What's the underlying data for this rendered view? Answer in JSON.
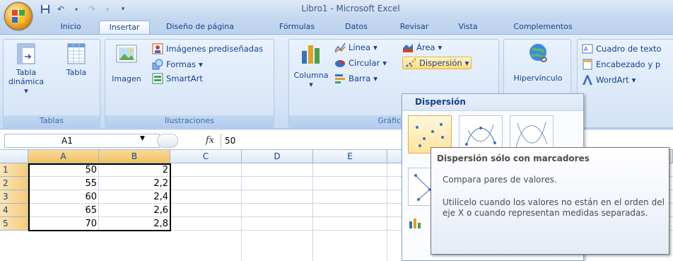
{
  "window": {
    "title": "Libro1 - Microsoft Excel"
  },
  "quick_access": [
    {
      "icon": "save-icon",
      "glyph": "▣"
    },
    {
      "icon": "undo-icon",
      "glyph": "↶"
    },
    {
      "icon": "redo-icon",
      "glyph": "↷"
    },
    {
      "icon": "customize-qat-icon",
      "glyph": "▾"
    }
  ],
  "tabs": [
    {
      "label": "Inicio",
      "active": false
    },
    {
      "label": "Insertar",
      "active": true
    },
    {
      "label": "Diseño de página",
      "active": false
    },
    {
      "label": "Fórmulas",
      "active": false
    },
    {
      "label": "Datos",
      "active": false
    },
    {
      "label": "Revisar",
      "active": false
    },
    {
      "label": "Vista",
      "active": false
    },
    {
      "label": "Complementos",
      "active": false
    }
  ],
  "ribbon": {
    "tablas": {
      "label": "Tablas",
      "pivot_line1": "Tabla",
      "pivot_line2": "dinámica",
      "table": "Tabla"
    },
    "ilustraciones": {
      "label": "Ilustraciones",
      "image": "Imagen",
      "clipart": "Imágenes prediseñadas",
      "shapes": "Formas",
      "smartart": "SmartArt"
    },
    "graficos": {
      "label": "Gráficos",
      "column": "Columna",
      "line": "Línea",
      "pie": "Circular",
      "bar": "Barra",
      "area": "Área",
      "scatter": "Dispersión"
    },
    "vinculos": {
      "hyperlink": "Hipervínculo"
    },
    "texto": {
      "textbox": "Cuadro de texto",
      "header": "Encabezado y p",
      "wordart": "WordArt"
    }
  },
  "formula_bar": {
    "name_box": "A1",
    "fx": "fx",
    "content": "50"
  },
  "grid": {
    "columns": [
      "A",
      "B",
      "C",
      "D",
      "E"
    ],
    "rows": [
      {
        "n": "1",
        "a": "50",
        "b": "2"
      },
      {
        "n": "2",
        "a": "55",
        "b": "2,2"
      },
      {
        "n": "3",
        "a": "60",
        "b": "2,4"
      },
      {
        "n": "4",
        "a": "65",
        "b": "2,6"
      },
      {
        "n": "5",
        "a": "70",
        "b": "2,8"
      }
    ]
  },
  "scatter_gallery": {
    "title": "Dispersión"
  },
  "tooltip": {
    "title": "Dispersión sólo con marcadores",
    "description": "Compara pares de valores.",
    "detail": "Utilícelo cuando los valores no están en el orden del eje X o cuando representan medidas separadas."
  },
  "colors": {
    "accent": "#15428b",
    "ribbon": "#d6e5f7",
    "selected": "#f6cc7c"
  }
}
